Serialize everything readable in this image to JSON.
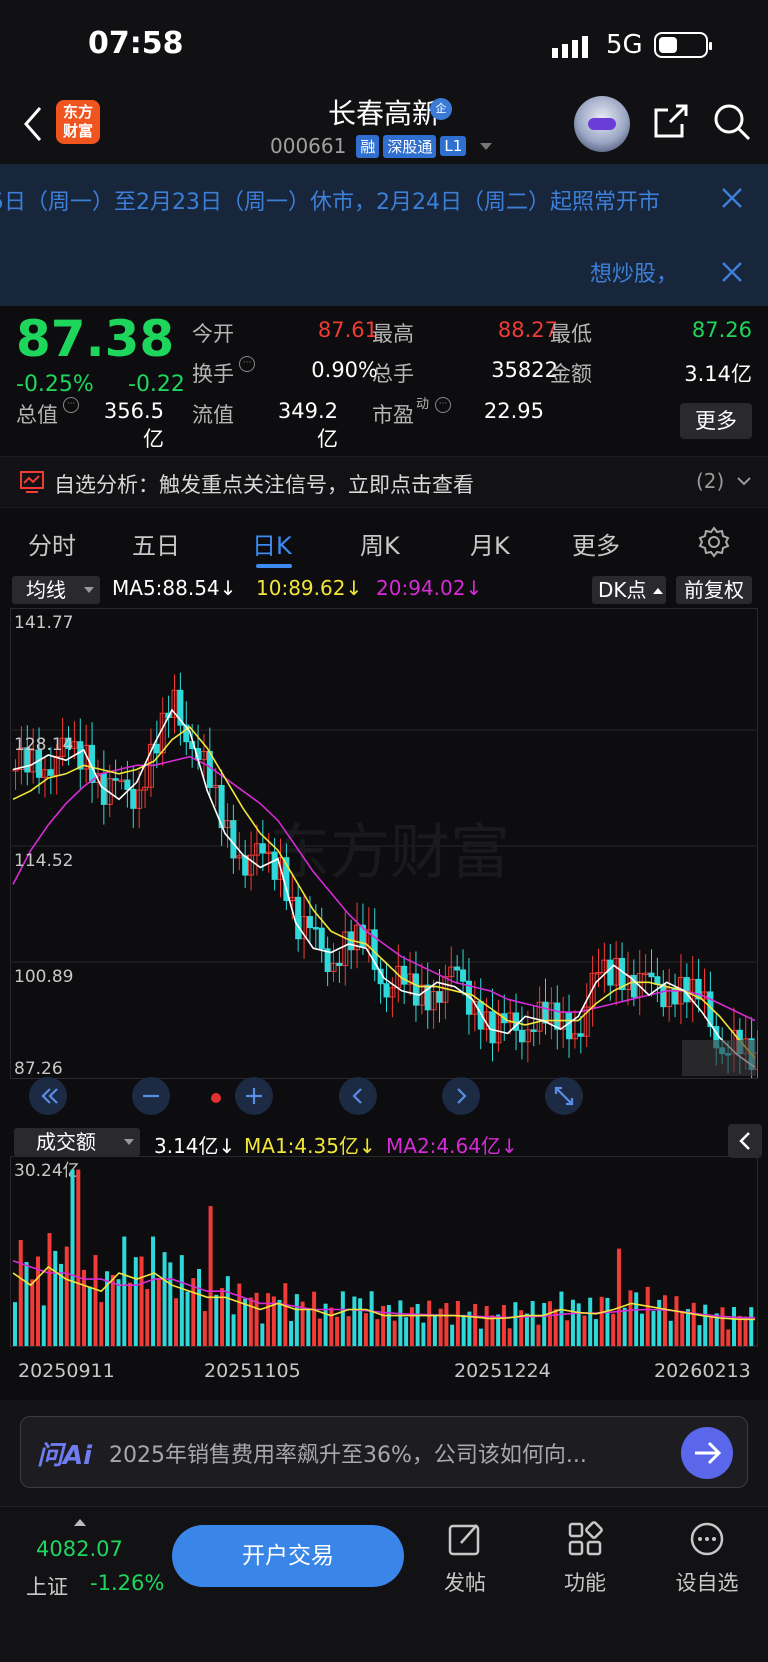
{
  "status_bar": {
    "time": "07:58",
    "network": "5G"
  },
  "header": {
    "logo_text": "东方财富",
    "stock_name": "长春高新",
    "verified_badge": "企",
    "stock_code": "000661",
    "tags": [
      "融",
      "深股通",
      "L1"
    ]
  },
  "notices": {
    "holiday": "5日（周一）至2月23日（周一）休市，2月24日（周二）起照常开市",
    "promo": "想炒股，"
  },
  "quote": {
    "price": "87.38",
    "change_pct": "-0.25%",
    "change_amt": "-0.22",
    "fields": [
      {
        "label": "今开",
        "value": "87.61",
        "color": "#f03b36"
      },
      {
        "label": "最高",
        "value": "88.27",
        "color": "#f03b36"
      },
      {
        "label": "最低",
        "value": "87.26",
        "color": "#1fd65d"
      },
      {
        "label": "换手",
        "value": "0.90%",
        "color": "#ffffff"
      },
      {
        "label": "总手",
        "value": "35822",
        "color": "#ffffff"
      },
      {
        "label": "金额",
        "value": "3.14亿",
        "color": "#ffffff"
      },
      {
        "label": "总值",
        "value": "356.5亿",
        "color": "#ffffff"
      },
      {
        "label": "流值",
        "value": "349.2亿",
        "color": "#ffffff"
      },
      {
        "label": "市盈",
        "label_sup": "动",
        "value": "22.95",
        "color": "#ffffff"
      }
    ],
    "more_label": "更多"
  },
  "signal": {
    "text": "自选分析：触发重点关注信号，立即点击查看",
    "count": "(2)"
  },
  "tabs": [
    "分时",
    "五日",
    "日K",
    "周K",
    "月K",
    "更多"
  ],
  "active_tab": 2,
  "kline": {
    "indicator_select": "均线",
    "ma5": "MA5:88.54↓",
    "ma10": "10:89.62↓",
    "ma20": "20:94.02↓",
    "dk_select": "DK点",
    "adjust_label": "前复权",
    "watermark": "东方财富",
    "y_labels": [
      "141.77",
      "128.14",
      "114.52",
      "100.89",
      "87.26"
    ]
  },
  "volume": {
    "indicator_select": "成交额",
    "value": "3.14亿↓",
    "ma1": "MA1:4.35亿↓",
    "ma2": "MA2:4.64亿↓",
    "max_label": "30.24亿"
  },
  "chart_data": {
    "type": "candlestick",
    "y_range": [
      87.26,
      141.77
    ],
    "x_labels": [
      "20250911",
      "20251105",
      "20251224",
      "20260213"
    ],
    "ma_colors": {
      "ma5": "#ffffff",
      "ma10": "#f2e53a",
      "ma20": "#d62bd6"
    },
    "up_color": "#f03b36",
    "down_color": "#2fd9d9",
    "ma5_series": [
      123.5,
      124.0,
      125.2,
      124.6,
      125.8,
      121.5,
      120.0,
      122.0,
      126.5,
      130.5,
      128.0,
      121.0,
      116.0,
      113.5,
      112.0,
      113.0,
      105.5,
      102.5,
      102.0,
      103.0,
      102.5,
      99.0,
      97.5,
      97.0,
      98.5,
      98.0,
      96.5,
      93.0,
      92.5,
      94.5,
      94.0,
      93.0,
      94.5,
      98.5,
      100.5,
      99.0,
      97.0,
      98.5,
      97.5,
      95.0,
      92.0,
      90.0,
      88.5
    ],
    "ma10_series": [
      120.0,
      121.0,
      122.5,
      123.0,
      124.0,
      123.5,
      123.0,
      123.5,
      124.5,
      127.0,
      128.5,
      126.0,
      122.5,
      119.0,
      116.0,
      114.0,
      110.5,
      107.0,
      104.5,
      103.5,
      103.0,
      101.0,
      99.0,
      98.0,
      98.0,
      97.5,
      97.0,
      95.5,
      94.0,
      93.5,
      94.0,
      94.0,
      94.0,
      96.0,
      97.5,
      98.5,
      98.5,
      98.0,
      97.5,
      96.5,
      94.5,
      92.0,
      89.6
    ],
    "ma20_series": [
      110.0,
      114.0,
      117.0,
      119.5,
      121.5,
      123.0,
      123.5,
      124.0,
      124.0,
      124.5,
      125.0,
      124.0,
      122.5,
      121.0,
      119.5,
      117.5,
      114.5,
      111.5,
      109.0,
      106.5,
      104.5,
      103.0,
      101.5,
      100.5,
      99.5,
      98.5,
      98.0,
      97.5,
      96.5,
      96.0,
      95.5,
      95.0,
      95.0,
      95.5,
      96.0,
      96.5,
      97.0,
      97.5,
      97.5,
      97.0,
      96.0,
      95.0,
      94.0
    ],
    "volume_range": [
      0,
      30.24
    ],
    "volume_ma1": [
      12,
      10,
      13,
      11,
      10,
      9,
      12,
      11,
      12,
      10,
      9,
      8,
      8,
      7,
      6,
      7,
      6,
      6,
      5,
      6,
      6,
      5,
      5,
      5,
      5,
      5,
      4.8,
      4.5,
      4.6,
      5,
      5,
      6,
      5.5,
      5.3,
      6,
      7,
      6.5,
      6,
      5.5,
      5,
      4.6,
      4.4,
      4.35
    ],
    "volume_ma2": [
      14,
      13,
      12,
      12,
      11,
      11,
      10,
      10,
      11,
      11,
      10,
      9,
      9,
      8,
      7,
      7,
      6.5,
      6,
      6,
      6,
      5.8,
      5.5,
      5.3,
      5.2,
      5.1,
      5,
      4.9,
      4.8,
      4.7,
      4.8,
      4.9,
      5.2,
      5.4,
      5.4,
      5.6,
      5.9,
      6,
      5.9,
      5.6,
      5.2,
      4.9,
      4.7,
      4.64
    ]
  },
  "ai_bar": {
    "logo": "问Ai",
    "question": "2025年销售费用率飙升至36%，公司该如何向..."
  },
  "bottom_nav": {
    "index_value": "4082.07",
    "index_name": "上证",
    "index_change": "-1.26%",
    "trade_label": "开户交易",
    "post_label": "发帖",
    "func_label": "功能",
    "watch_label": "设自选"
  }
}
